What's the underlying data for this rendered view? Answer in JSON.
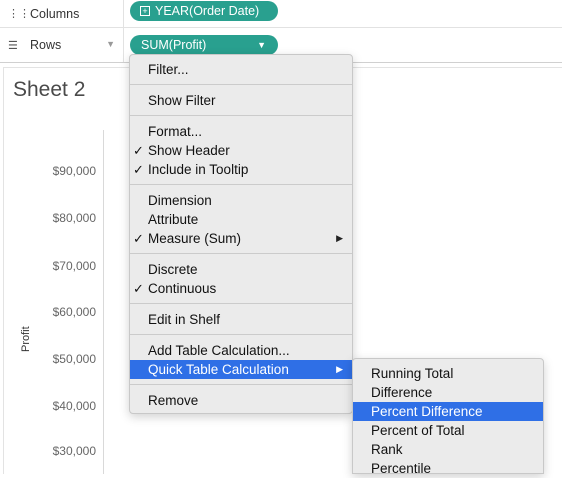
{
  "shelves": {
    "columns": {
      "label": "Columns",
      "icon": "columns-icon",
      "pill": "YEAR(Order Date)"
    },
    "rows": {
      "label": "Rows",
      "icon": "rows-icon",
      "pill": "SUM(Profit)"
    }
  },
  "colors": {
    "pill": "#29a08f",
    "highlight": "#2f6fe6",
    "menu_bg": "#ebebeb"
  },
  "sheet": {
    "title": "Sheet 2",
    "y_axis_label": "Profit",
    "ticks": [
      "$90,000",
      "$80,000",
      "$70,000",
      "$60,000",
      "$50,000",
      "$40,000",
      "$30,000"
    ]
  },
  "context_menu": {
    "filter": "Filter...",
    "show_filter": "Show Filter",
    "format": "Format...",
    "show_header": "Show Header",
    "include_tooltip": "Include in Tooltip",
    "dimension": "Dimension",
    "attribute": "Attribute",
    "measure": "Measure (Sum)",
    "discrete": "Discrete",
    "continuous": "Continuous",
    "edit_in_shelf": "Edit in Shelf",
    "add_table_calc": "Add Table Calculation...",
    "quick_table_calc": "Quick Table Calculation",
    "remove": "Remove",
    "checked": [
      "Show Header",
      "Include in Tooltip",
      "Measure (Sum)",
      "Continuous"
    ],
    "highlighted": "Quick Table Calculation"
  },
  "submenu": {
    "items": [
      "Running Total",
      "Difference",
      "Percent Difference",
      "Percent of Total",
      "Rank",
      "Percentile"
    ],
    "highlighted": "Percent Difference"
  }
}
